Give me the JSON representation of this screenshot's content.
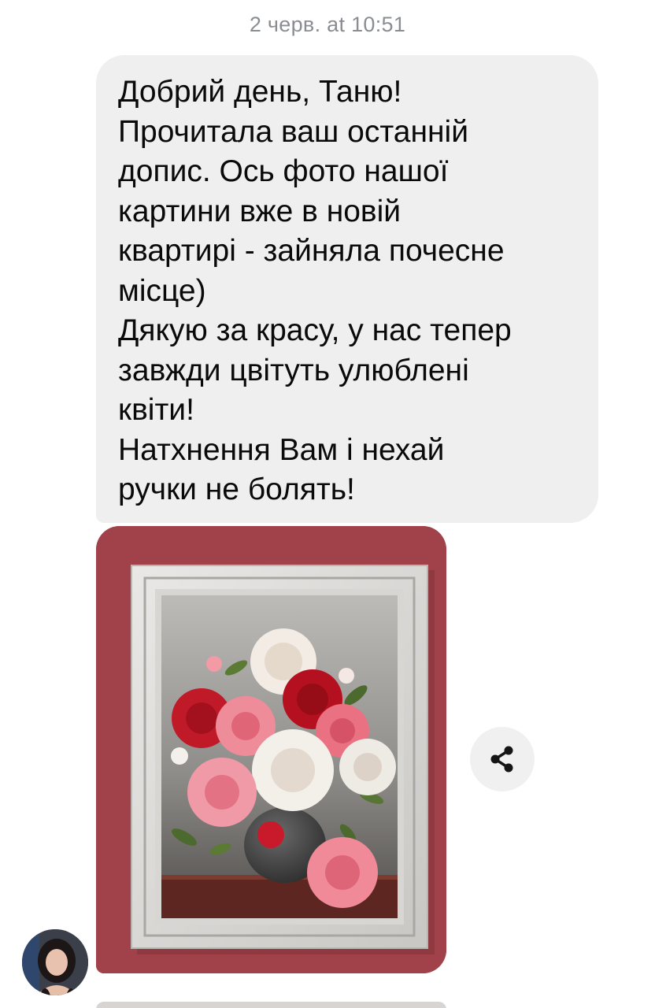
{
  "chat": {
    "timestamp": "2 черв. at 10:51",
    "message": {
      "lines": [
        "Добрий день, Таню!",
        "Прочитала ваш останній",
        "допис. Ось фото нашої",
        "картини вже в новій",
        "квартирі - зайняла почесне",
        "місце)",
        "Дякую за красу, у нас тепер",
        "завжди цвітуть улюблені",
        "квіти!",
        "Натхнення Вам і нехай",
        "ручки не болять!"
      ]
    },
    "photo": {
      "icon": "framed-peony-painting",
      "wall_color": "#a8454e"
    },
    "share_button": {
      "icon": "share-icon"
    },
    "avatar": {
      "icon": "user-avatar"
    }
  },
  "colors": {
    "bubble": "#efeff0",
    "timestamp": "#8a8d91",
    "text": "#0a0a0a",
    "share_bg": "#f0f0f1"
  }
}
